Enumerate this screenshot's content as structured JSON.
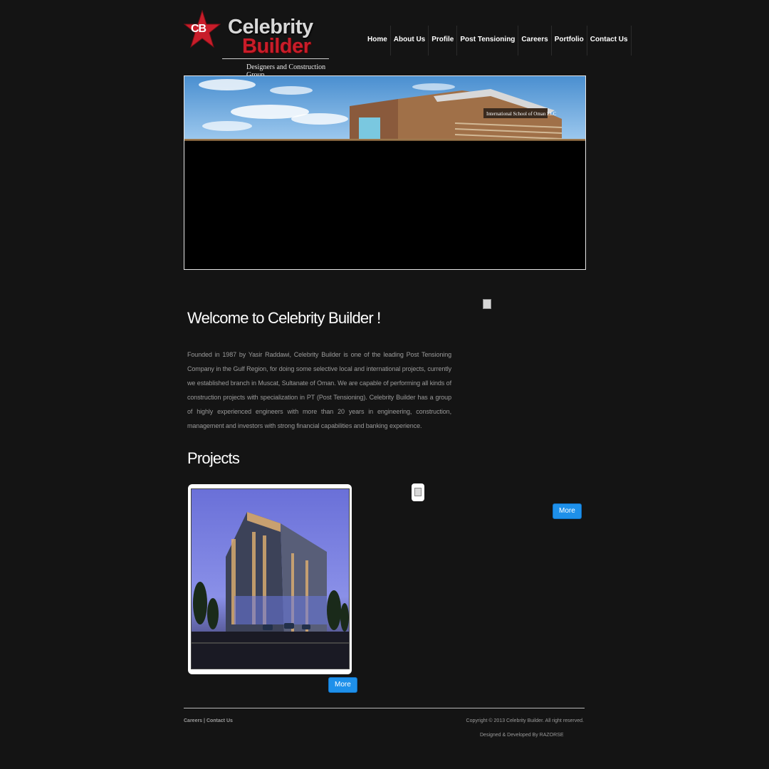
{
  "header": {
    "logo": {
      "initials": "CB",
      "title_line1": "Celebrity",
      "title_line2": "Builder",
      "tagline": "Designers and Construction Group"
    },
    "nav": [
      {
        "label": "Home"
      },
      {
        "label": "About Us"
      },
      {
        "label": "Profile"
      },
      {
        "label": "Post Tensioning"
      },
      {
        "label": "Careers"
      },
      {
        "label": "Portfolio"
      },
      {
        "label": "Contact Us"
      }
    ]
  },
  "banner": {
    "sign_text": "International School of Oman LLC"
  },
  "welcome": {
    "title": "Welcome to Celebrity Builder !",
    "body": "Founded in 1987 by Yasir Raddawi, Celebrity Builder is one of the leading Post Tensioning Company in the Gulf Region, for doing some selective local and international projects, currently we established branch in Muscat, Sultanate of Oman. We are capable of performing all kinds of construction projects with specialization in PT (Post Tensioning). Celebrity Builder has a group of highly experienced engineers with more than 20 years in engineering, construction, management and investors with strong financial capabilities and banking experience."
  },
  "projects": {
    "title": "Projects",
    "more_label_1": "More",
    "more_label_2": "More"
  },
  "footer": {
    "link_careers": "Careers",
    "separator": "|",
    "link_contact": "Contact Us",
    "copyright": "Copyright © 2013 Celebrity Builder. All right reserved.",
    "credit": "Designed & Developed By RAZORSE"
  },
  "colors": {
    "background": "#141414",
    "brand_red": "#c81d2a",
    "button_blue": "#1e90ea"
  }
}
